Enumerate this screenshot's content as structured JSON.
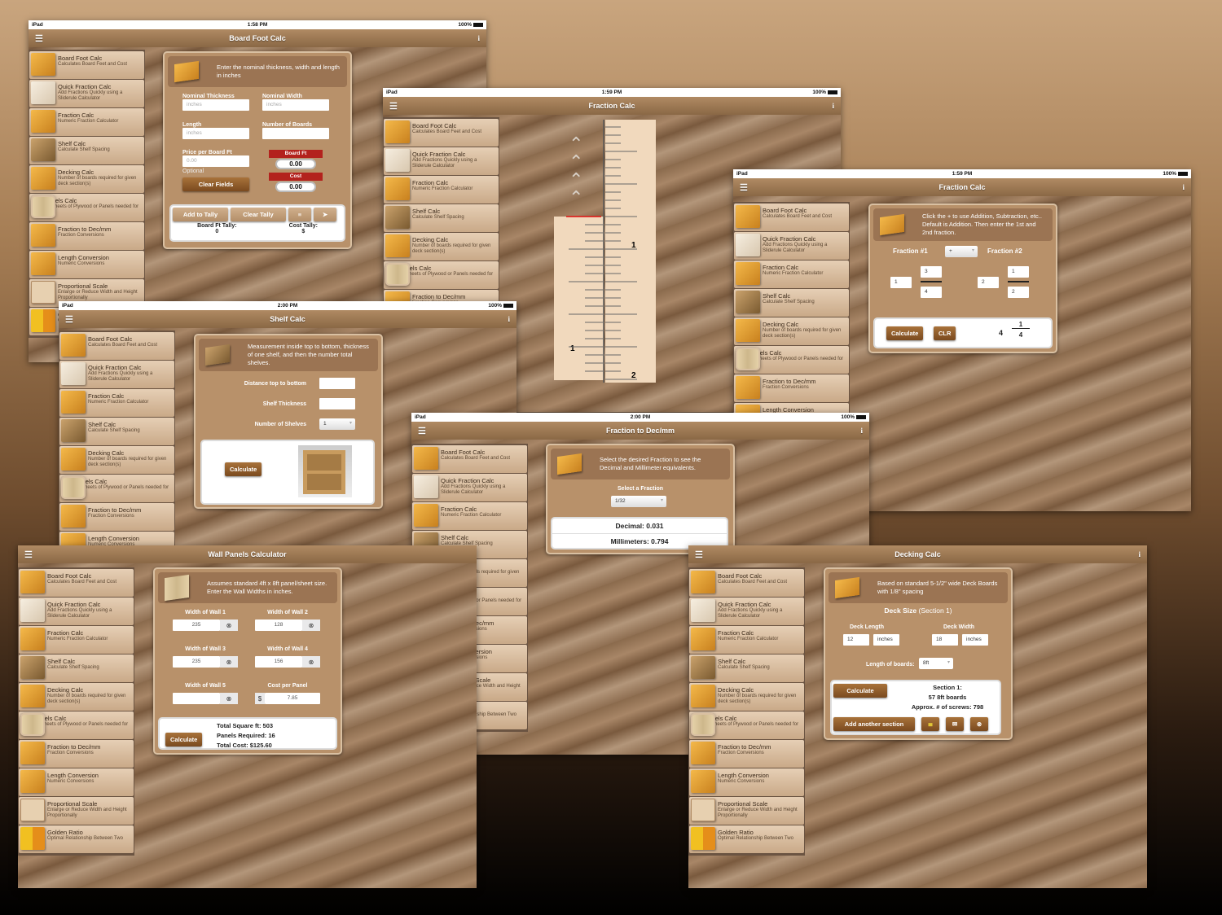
{
  "sidebar_items": [
    {
      "title": "Board Foot Calc",
      "sub": "Calculates Board Feet and Cost",
      "icon": "board-foot-icon"
    },
    {
      "title": "Quick Fraction Calc",
      "sub": "Add Fractions Quickly using a Sliderule Calculator",
      "icon": "slide-rule-icon"
    },
    {
      "title": "Fraction Calc",
      "sub": "Numeric Fraction Calculator",
      "icon": "fraction-icon"
    },
    {
      "title": "Shelf Calc",
      "sub": "Calculate Shelf Spacing",
      "icon": "shelf-icon"
    },
    {
      "title": "Decking Calc",
      "sub": "Number of boards required for given deck section(s)",
      "icon": "decking-icon"
    },
    {
      "title": "Wall Panels Calc",
      "sub": "Estimate Sheets of Plywood or Panels needed for a Project",
      "icon": "wall-panels-icon"
    },
    {
      "title": "Fraction to Dec/mm",
      "sub": "Fraction Conversions",
      "icon": "fraction-dec-icon"
    },
    {
      "title": "Length Conversion",
      "sub": "Numeric Conversions",
      "icon": "length-icon"
    },
    {
      "title": "Proportional Scale",
      "sub": "Enlarge or Reduce Width and Height Proportionally",
      "icon": "scale-arrows-icon"
    },
    {
      "title": "Golden Ratio",
      "sub": "Optimal Relationship Between Two",
      "icon": "golden-ratio-icon"
    }
  ],
  "status": {
    "device": "iPad",
    "battery": "100%"
  },
  "board_foot": {
    "time": "1:58 PM",
    "title": "Board Foot Calc",
    "intro": "Enter the nominal thickness, width and length in inches",
    "thickness_label": "Nominal Thickness",
    "thickness_ph": "inches",
    "width_label": "Nominal Width",
    "width_ph": "inches",
    "length_label": "Length",
    "length_ph": "inches",
    "boards_label": "Number of Boards",
    "price_label": "Price per Board Ft",
    "price_ph": "0.00",
    "optional": "Optional",
    "board_ft_label": "Board Ft",
    "board_ft_value": "0.00",
    "cost_label": "Cost",
    "cost_value": "0.00",
    "clear_fields": "Clear Fields",
    "add_tally": "Add to Tally",
    "clear_tally": "Clear Tally",
    "bf_tally_label": "Board Ft Tally:",
    "bf_tally_value": "0",
    "cost_tally_label": "Cost Tally:",
    "cost_tally_value": "$"
  },
  "slide_rule": {
    "time": "1:59 PM",
    "title": "Fraction Calc",
    "mark_1": "1",
    "mark_2": "2"
  },
  "fraction_calc": {
    "time": "1:59 PM",
    "title": "Fraction Calc",
    "intro": "Click the + to use Addition, Subtraction, etc.. Default is Addition. Then enter the 1st and 2nd fraction.",
    "f1_label": "Fraction #1",
    "f2_label": "Fraction #2",
    "operator": "+",
    "f1_whole": "1",
    "f1_num": "3",
    "f1_den": "4",
    "f2_whole": "2",
    "f2_num": "1",
    "f2_den": "2",
    "calculate": "Calculate",
    "clr": "CLR",
    "result_whole": "4",
    "result_num": "1",
    "result_den": "4"
  },
  "shelf": {
    "time": "2:00 PM",
    "title": "Shelf Calc",
    "intro": "Measurement inside top to bottom, thickness of one shelf, and then the number total shelves.",
    "distance_label": "Distance top to bottom",
    "thickness_label": "Shelf Thickness",
    "shelves_label": "Number of Shelves",
    "shelves_value": "1",
    "calculate": "Calculate"
  },
  "frac_dec": {
    "time": "2:00 PM",
    "title": "Fraction to Dec/mm",
    "intro": "Select the desired Fraction to see the Decimal and Millimeter equivalents.",
    "select_label": "Select a Fraction",
    "selected": "1/32",
    "decimal": "Decimal: 0.031",
    "mm": "Millimeters: 0.794"
  },
  "wall": {
    "title": "Wall Panels Calculator",
    "intro": "Assumes standard 4ft x 8ft panel/sheet size. Enter the Wall Widths in inches.",
    "w1_label": "Width of Wall 1",
    "w1": "235",
    "w2_label": "Width of Wall 2",
    "w2": "128",
    "w3_label": "Width of Wall 3",
    "w3": "235",
    "w4_label": "Width of Wall 4",
    "w4": "156",
    "w5_label": "Width of Wall 5",
    "w5": "",
    "cost_label": "Cost per Panel",
    "currency": "$",
    "cost": "7.85",
    "calculate": "Calculate",
    "total_sqft": "Total Square ft: 503",
    "panels": "Panels Required: 16",
    "total_cost": "Total Cost: $125.60"
  },
  "decking": {
    "title": "Decking Calc",
    "intro": "Based on standard 5-1/2\" wide Deck Boards with 1/8\" spacing",
    "deck_size": "Deck Size",
    "section": "(Section 1)",
    "length_label": "Deck Length",
    "length": "12",
    "length_unit": "inches",
    "width_label": "Deck Width",
    "width": "18",
    "width_unit": "inches",
    "boards_label": "Length of boards:",
    "boards_value": "8ft",
    "calculate": "Calculate",
    "result_section": "Section 1:",
    "result_boards": "57 8ft boards",
    "result_screws": "Approx. # of screws: 798",
    "add_section": "Add another section"
  }
}
